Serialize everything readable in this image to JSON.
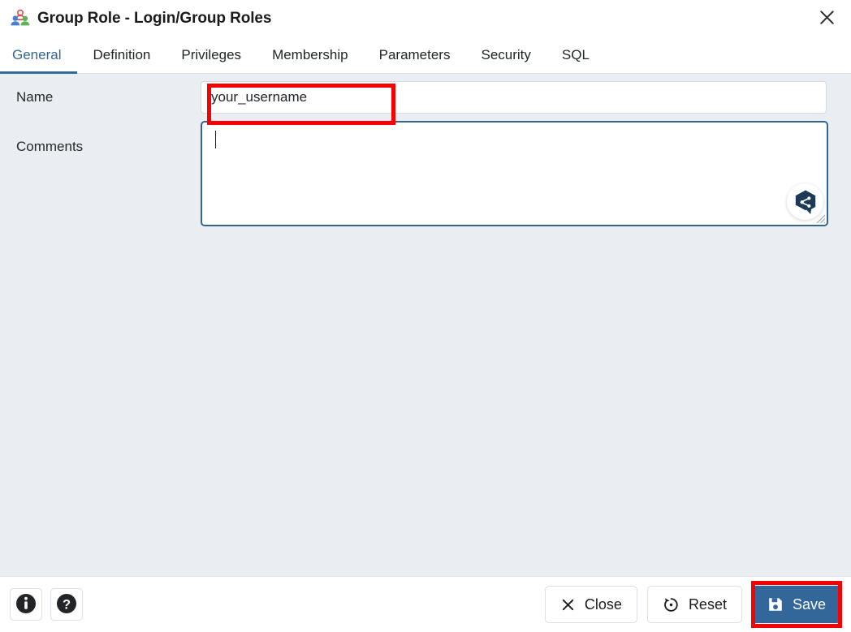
{
  "window": {
    "title": "Group Role - Login/Group Roles",
    "title_icon": "group-role-icon",
    "close_icon": "close-icon",
    "close_label": "Close dialog"
  },
  "tabs": [
    {
      "label": "General",
      "active": true
    },
    {
      "label": "Definition",
      "active": false
    },
    {
      "label": "Privileges",
      "active": false
    },
    {
      "label": "Membership",
      "active": false
    },
    {
      "label": "Parameters",
      "active": false
    },
    {
      "label": "Security",
      "active": false
    },
    {
      "label": "SQL",
      "active": false
    }
  ],
  "form": {
    "name": {
      "label": "Name",
      "value": "your_username",
      "placeholder": ""
    },
    "comments": {
      "label": "Comments",
      "value": "",
      "placeholder": "",
      "focused": true,
      "assistant_icon": "writing-assistant-icon",
      "resize_icon": "resize-grip-icon"
    }
  },
  "footer": {
    "info_icon": "info-icon",
    "help_icon": "help-icon",
    "buttons": [
      {
        "label": "Close",
        "icon": "x-icon",
        "primary": false
      },
      {
        "label": "Reset",
        "icon": "reset-icon",
        "primary": false
      },
      {
        "label": "Save",
        "icon": "save-disk-icon",
        "primary": true
      }
    ]
  },
  "annotations": [
    {
      "name": "name-field-highlight",
      "color": "#f70000"
    },
    {
      "name": "save-button-highlight",
      "color": "#f70000"
    }
  ],
  "colors": {
    "accent": "#33679a",
    "body_bg": "#eaedf1",
    "panel_bg": "#ffffff",
    "annotation": "#f70000",
    "focus_border": "#33658f"
  }
}
